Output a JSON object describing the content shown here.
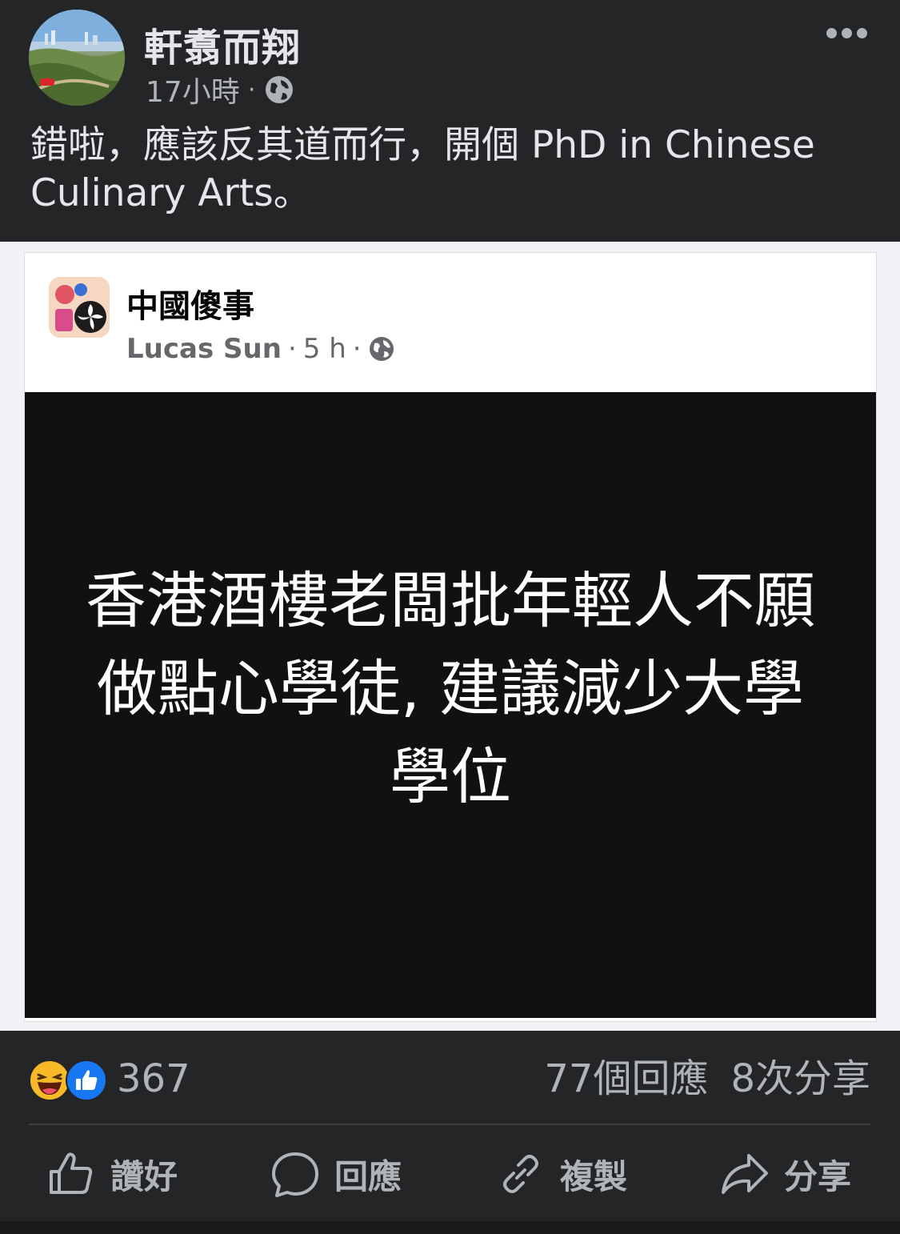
{
  "post": {
    "author": "軒翥而翔",
    "time": "17小時",
    "dot": "·",
    "privacy_icon": "globe-icon",
    "text": "錯啦，應該反其道而行，開個 PhD in Chinese Culinary Arts。"
  },
  "shared": {
    "page_name": "中國傻事",
    "author": "Lucas Sun",
    "sep1": "·",
    "time": "5 h",
    "sep2": "·",
    "headline": "香港酒樓老闆批年輕人不願做點心學徒, 建議減少大學學位"
  },
  "engagement": {
    "reaction_count": "367",
    "comments": "77個回應",
    "shares": "8次分享",
    "reaction_icons": [
      "haha-icon",
      "like-icon"
    ]
  },
  "actions": {
    "like": "讚好",
    "comment": "回應",
    "copy": "複製",
    "share": "分享"
  },
  "colors": {
    "background": "#242526",
    "text_primary": "#e4e6eb",
    "text_secondary": "#b0b3b8",
    "like_blue": "#1877f2",
    "haha_yellow": "#f7b928"
  }
}
